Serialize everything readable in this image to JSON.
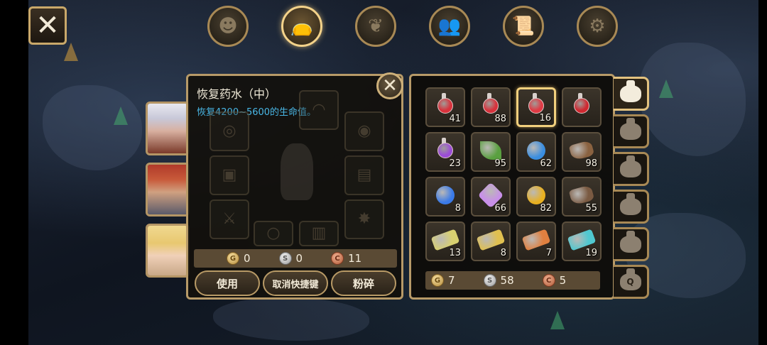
{
  "top_bar": {
    "close_icon": "close-x",
    "icons": [
      {
        "name": "character-icon",
        "glyph": "☻",
        "active": false
      },
      {
        "name": "bag-icon",
        "glyph": "👝",
        "active": true
      },
      {
        "name": "skill-leaf-icon",
        "glyph": "❦",
        "active": false
      },
      {
        "name": "party-icon",
        "glyph": "👥",
        "active": false
      },
      {
        "name": "quest-scroll-icon",
        "glyph": "📜",
        "active": false
      },
      {
        "name": "settings-gear-icon",
        "glyph": "⚙",
        "active": false
      }
    ]
  },
  "portraits": [
    {
      "name": "portrait-white-hair-hero"
    },
    {
      "name": "portrait-red-hair-warrior"
    },
    {
      "name": "portrait-blonde-girl"
    }
  ],
  "item_detail": {
    "name": "恢复药水（中）",
    "description": "恢复4200~5600的生命值。",
    "price": {
      "gold": "0",
      "silver": "0",
      "copper": "11"
    },
    "buttons": {
      "use": "使用",
      "cancel_shortcut": "取消快捷键",
      "smash": "粉碎"
    }
  },
  "inventory": {
    "items": [
      {
        "name": "small-red-potion",
        "count": "41",
        "color": "#d8323c",
        "kind": "potion"
      },
      {
        "name": "medium-red-potion",
        "count": "88",
        "color": "#d8323c",
        "kind": "potion"
      },
      {
        "name": "red-potion-selected",
        "count": "16",
        "color": "#e03a44",
        "kind": "potion",
        "selected": true
      },
      {
        "name": "large-red-potion",
        "count": "",
        "color": "#d02830",
        "kind": "potion"
      },
      {
        "name": "purple-potion",
        "count": "23",
        "color": "#9b4dd6",
        "kind": "potion"
      },
      {
        "name": "green-herb",
        "count": "95",
        "color": "#5aa040",
        "kind": "leaf"
      },
      {
        "name": "blue-gem-orb",
        "count": "62",
        "color": "#3a8ee0",
        "kind": "orb"
      },
      {
        "name": "leather-hide",
        "count": "98",
        "color": "#8a6240",
        "kind": "hide"
      },
      {
        "name": "blue-swirl-orb",
        "count": "8",
        "color": "#3a7ae8",
        "kind": "orb"
      },
      {
        "name": "pink-crystal",
        "count": "66",
        "color": "#c890e8",
        "kind": "crystal"
      },
      {
        "name": "gold-apple",
        "count": "82",
        "color": "#e8b020",
        "kind": "orb"
      },
      {
        "name": "brown-claw",
        "count": "55",
        "color": "#7a5a42",
        "kind": "hide"
      },
      {
        "name": "yellow-scroll",
        "count": "13",
        "color": "#d8d070",
        "kind": "scroll"
      },
      {
        "name": "gold-scroll",
        "count": "8",
        "color": "#e0c050",
        "kind": "scroll"
      },
      {
        "name": "orange-seal-scroll",
        "count": "7",
        "color": "#e08040",
        "kind": "scroll"
      },
      {
        "name": "cyan-seal-scroll",
        "count": "19",
        "color": "#50c8d0",
        "kind": "scroll"
      }
    ],
    "currency": {
      "gold": "7",
      "silver": "58",
      "copper": "5"
    }
  },
  "bag_tabs": [
    {
      "name": "bag-tab-1",
      "label": "",
      "active": true
    },
    {
      "name": "bag-tab-2",
      "label": "",
      "active": false
    },
    {
      "name": "bag-tab-3",
      "label": "",
      "active": false
    },
    {
      "name": "bag-tab-4",
      "label": "",
      "active": false
    },
    {
      "name": "bag-tab-5",
      "label": "",
      "active": false
    },
    {
      "name": "bag-tab-quest",
      "label": "Q",
      "active": false
    }
  ]
}
